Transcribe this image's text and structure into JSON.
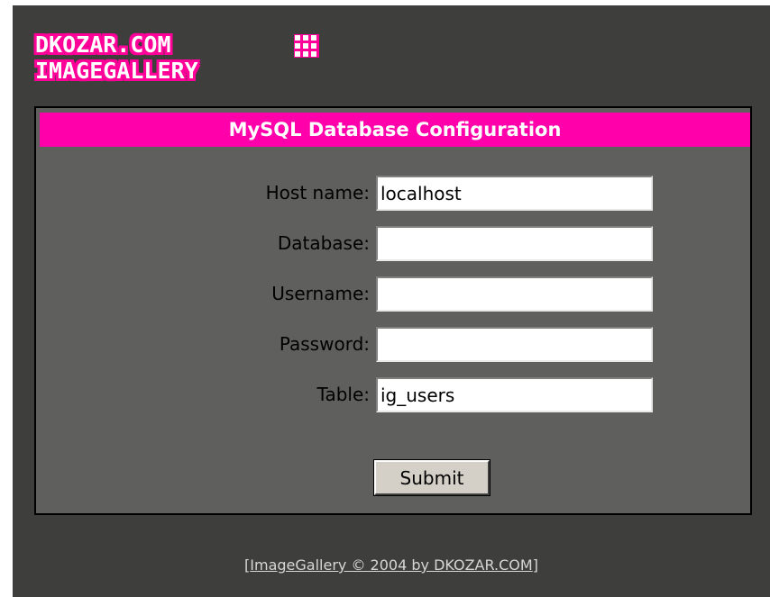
{
  "logo": {
    "line1": "DKOZAR.COM",
    "line2": "IMAGEGALLERY",
    "icon": "grid-logo-icon"
  },
  "panel": {
    "title": "MySQL Database Configuration",
    "fields": [
      {
        "label": "Host name:",
        "value": "localhost"
      },
      {
        "label": "Database:",
        "value": ""
      },
      {
        "label": "Username:",
        "value": ""
      },
      {
        "label": "Password:",
        "value": ""
      },
      {
        "label": "Table:",
        "value": "ig_users"
      }
    ],
    "submit_label": "Submit"
  },
  "footer": {
    "bracket_open": "[",
    "link_text": "ImageGallery © 2004 by DKOZAR.COM",
    "bracket_close": "]"
  },
  "colors": {
    "background": "#3e3f3c",
    "panel": "#5f605d",
    "accent": "#ff00aa"
  }
}
